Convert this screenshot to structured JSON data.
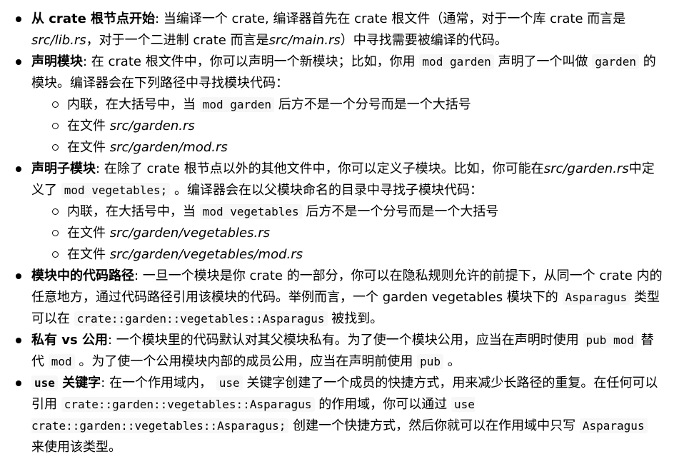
{
  "items": [
    {
      "term": "从 crate 根节点开始",
      "t1": ": 当编译一个 crate, 编译器首先在 crate 根文件（通常，对于一个库 crate 而言是",
      "e1": "src/lib.rs",
      "t2": "，对于一个二进制 crate 而言是",
      "e2": "src/main.rs",
      "t3": "）中寻找需要被编译的代码。"
    },
    {
      "term": "声明模块",
      "t1": ": 在 crate 根文件中，你可以声明一个新模块；比如，你用 ",
      "c1": "mod garden",
      "t2": " 声明了一个叫做 ",
      "c2": "garden",
      "t3": " 的模块。编译器会在下列路径中寻找模块代码：",
      "sub": [
        {
          "t1": "内联，在大括号中，当 ",
          "c1": "mod garden",
          "t2": " 后方不是一个分号而是一个大括号"
        },
        {
          "t1": "在文件 ",
          "e1": "src/garden.rs"
        },
        {
          "t1": "在文件 ",
          "e1": "src/garden/mod.rs"
        }
      ]
    },
    {
      "term": "声明子模块",
      "t1": ": 在除了 crate 根节点以外的其他文件中，你可以定义子模块。比如，你可能在",
      "e1": "src/garden.rs",
      "t2": "中定义了 ",
      "c1": "mod vegetables;",
      "t3": " 。编译器会在以父模块命名的目录中寻找子模块代码：",
      "sub": [
        {
          "t1": "内联，在大括号中，当 ",
          "c1": "mod vegetables",
          "t2": " 后方不是一个分号而是一个大括号"
        },
        {
          "t1": "在文件 ",
          "e1": "src/garden/vegetables.rs"
        },
        {
          "t1": "在文件 ",
          "e1": "src/garden/vegetables/mod.rs"
        }
      ]
    },
    {
      "term": "模块中的代码路径",
      "t1": ": 一旦一个模块是你 crate 的一部分，你可以在隐私规则允许的前提下，从同一个 crate 内的任意地方，通过代码路径引用该模块的代码。举例而言，一个 garden vegetables 模块下的 ",
      "c1": "Asparagus",
      "t2": " 类型可以在 ",
      "c2": "crate::garden::vegetables::Asparagus",
      "t3": " 被找到。"
    },
    {
      "term": "私有 vs 公用",
      "t1": ": 一个模块里的代码默认对其父模块私有。为了使一个模块公用，应当在声明时使用 ",
      "c1": "pub mod",
      "t2": " 替代 ",
      "c2": "mod",
      "t3": " 。为了使一个公用模块内部的成员公用，应当在声明前使用 ",
      "c3": "pub",
      "t4": " 。"
    },
    {
      "termCode": "use",
      "term": " 关键字",
      "t1": ": 在一个作用域内， ",
      "c1": "use",
      "t2": " 关键字创建了一个成员的快捷方式，用来减少长路径的重复。在任何可以引用 ",
      "c2": "crate::garden::vegetables::Asparagus",
      "t3": " 的作用域，你可以通过 ",
      "c3": "use crate::garden::vegetables::Asparagus;",
      "t4": " 创建一个快捷方式，然后你就可以在作用域中只写 ",
      "c4": "Asparagus",
      "t5": " 来使用该类型。"
    }
  ]
}
